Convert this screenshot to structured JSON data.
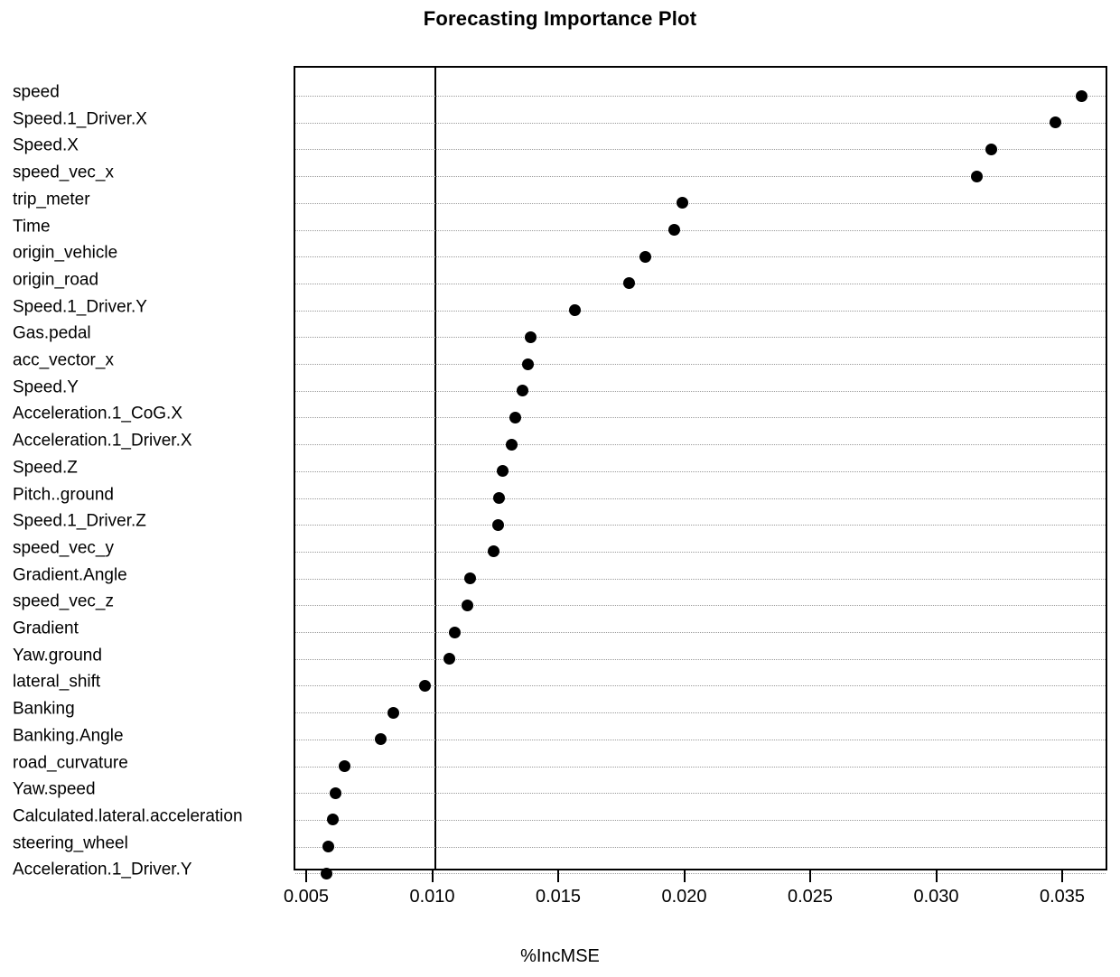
{
  "chart_data": {
    "type": "scatter",
    "title": "Forecasting Importance Plot",
    "xlabel": "%IncMSE",
    "ylabel": "",
    "xlim": [
      0.0045,
      0.0368
    ],
    "xticks": [
      0.005,
      0.01,
      0.015,
      0.02,
      0.025,
      0.03,
      0.035
    ],
    "xtick_labels": [
      "0.005",
      "0.010",
      "0.015",
      "0.020",
      "0.025",
      "0.030",
      "0.035"
    ],
    "grid": true,
    "grid_style": "dotted-horizontal",
    "legend": "none",
    "reference_line_x": 0.01,
    "point_color": "#000000",
    "grid_color": "#9a9a9a",
    "frame_color": "#000000",
    "categories": [
      "speed",
      "Speed.1_Driver.X",
      "Speed.X",
      "speed_vec_x",
      "trip_meter",
      "Time",
      "origin_vehicle",
      "origin_road",
      "Speed.1_Driver.Y",
      "Gas.pedal",
      "acc_vector_x",
      "Speed.Y",
      "Acceleration.1_CoG.X",
      "Acceleration.1_Driver.X",
      "Speed.Z",
      "Pitch..ground",
      "Speed.1_Driver.Z",
      "speed_vec_y",
      "Gradient.Angle",
      "speed_vec_z",
      "Gradient",
      "Yaw.ground",
      "lateral_shift",
      "Banking",
      "Banking.Angle",
      "road_curvature",
      "Yaw.speed",
      "Calculated.lateral.acceleration",
      "steering_wheel",
      "Acceleration.1_Driver.Y"
    ],
    "values": [
      0.0357,
      0.03466,
      0.03211,
      0.03154,
      0.01987,
      0.01955,
      0.01837,
      0.01773,
      0.01558,
      0.01385,
      0.01371,
      0.01353,
      0.01321,
      0.0131,
      0.01271,
      0.01258,
      0.01253,
      0.01235,
      0.01142,
      0.01131,
      0.01084,
      0.01061,
      0.00965,
      0.0084,
      0.00787,
      0.00644,
      0.00608,
      0.00597,
      0.00579,
      0.00572
    ]
  }
}
